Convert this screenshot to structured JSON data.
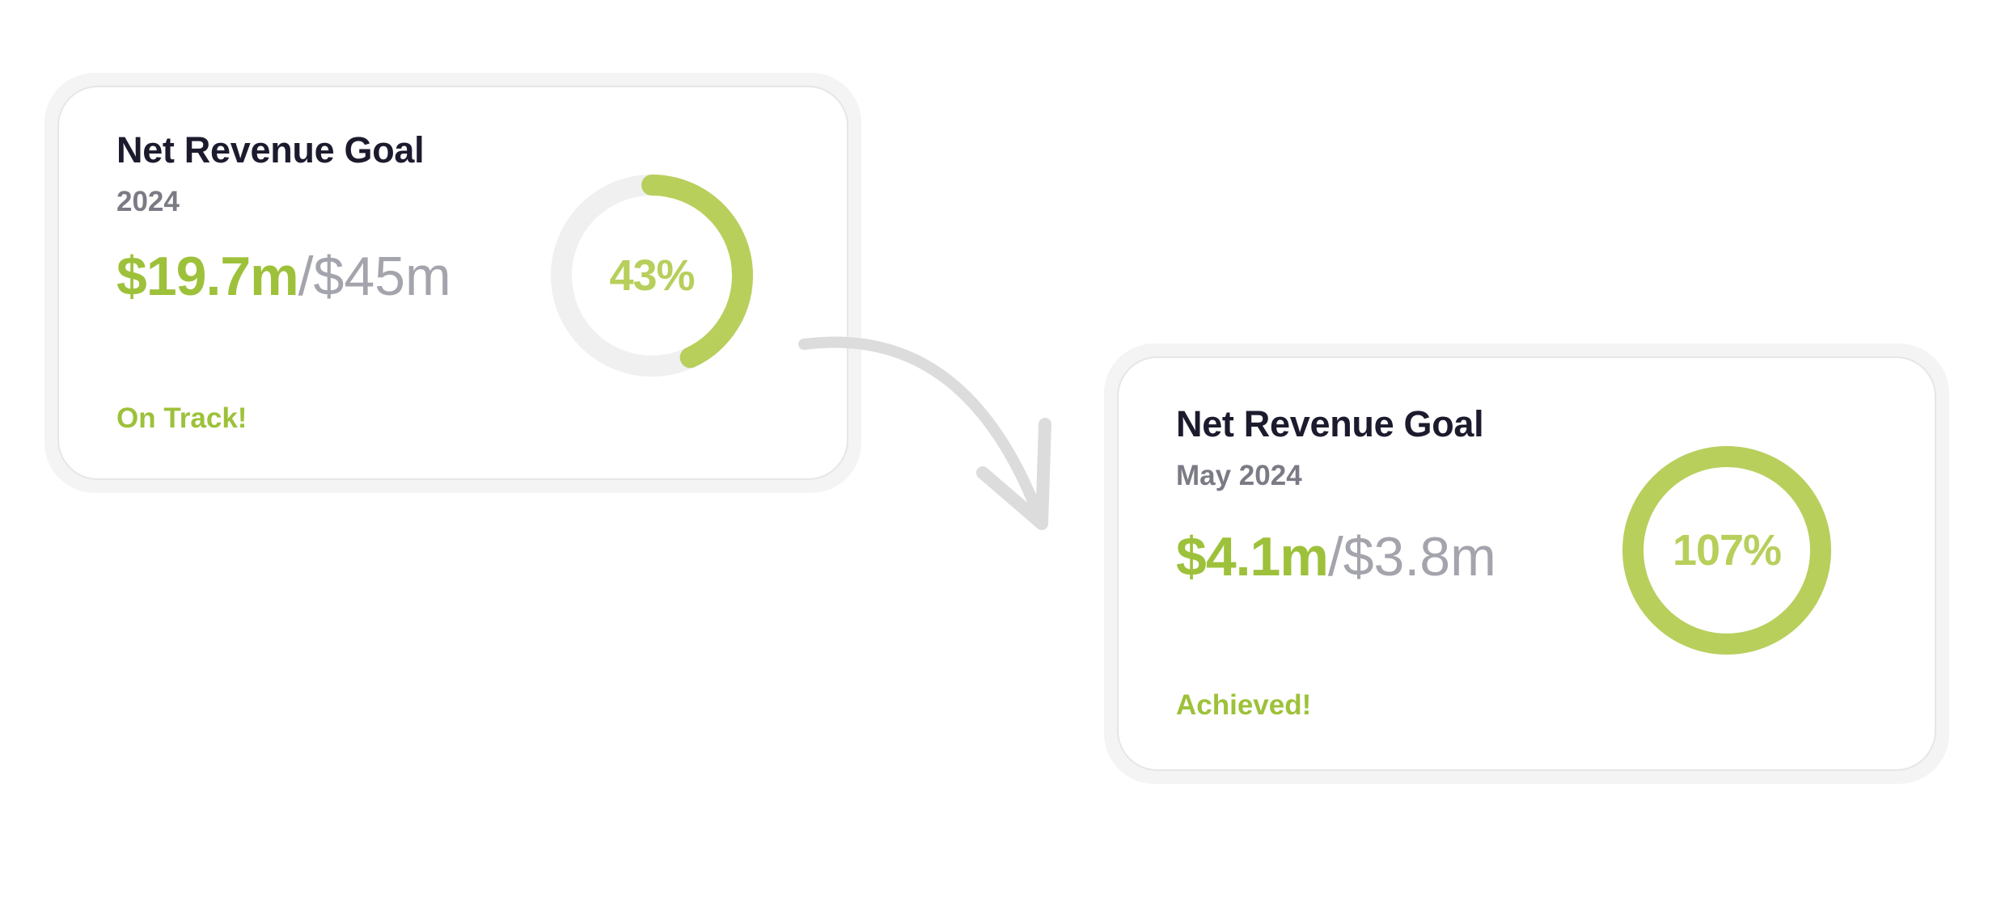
{
  "colors": {
    "accent": "#9dc13a",
    "ring_fill": "#b8cf5c",
    "ring_track": "#f0f0f1",
    "title": "#1c1b2e",
    "muted": "#a4a4ad",
    "arrow": "#dcdcdd"
  },
  "cards": [
    {
      "title": "Net Revenue Goal",
      "period": "2024",
      "actual": "$19.7m",
      "separator": "/",
      "target": "$45m",
      "percent_label": "43%",
      "percent_value": 43,
      "status": "On Track!"
    },
    {
      "title": "Net Revenue Goal",
      "period": "May 2024",
      "actual": "$4.1m",
      "separator": "/",
      "target": "$3.8m",
      "percent_label": "107%",
      "percent_value": 107,
      "status": "Achieved!"
    }
  ],
  "arrow_icon": "curved-arrow-icon"
}
